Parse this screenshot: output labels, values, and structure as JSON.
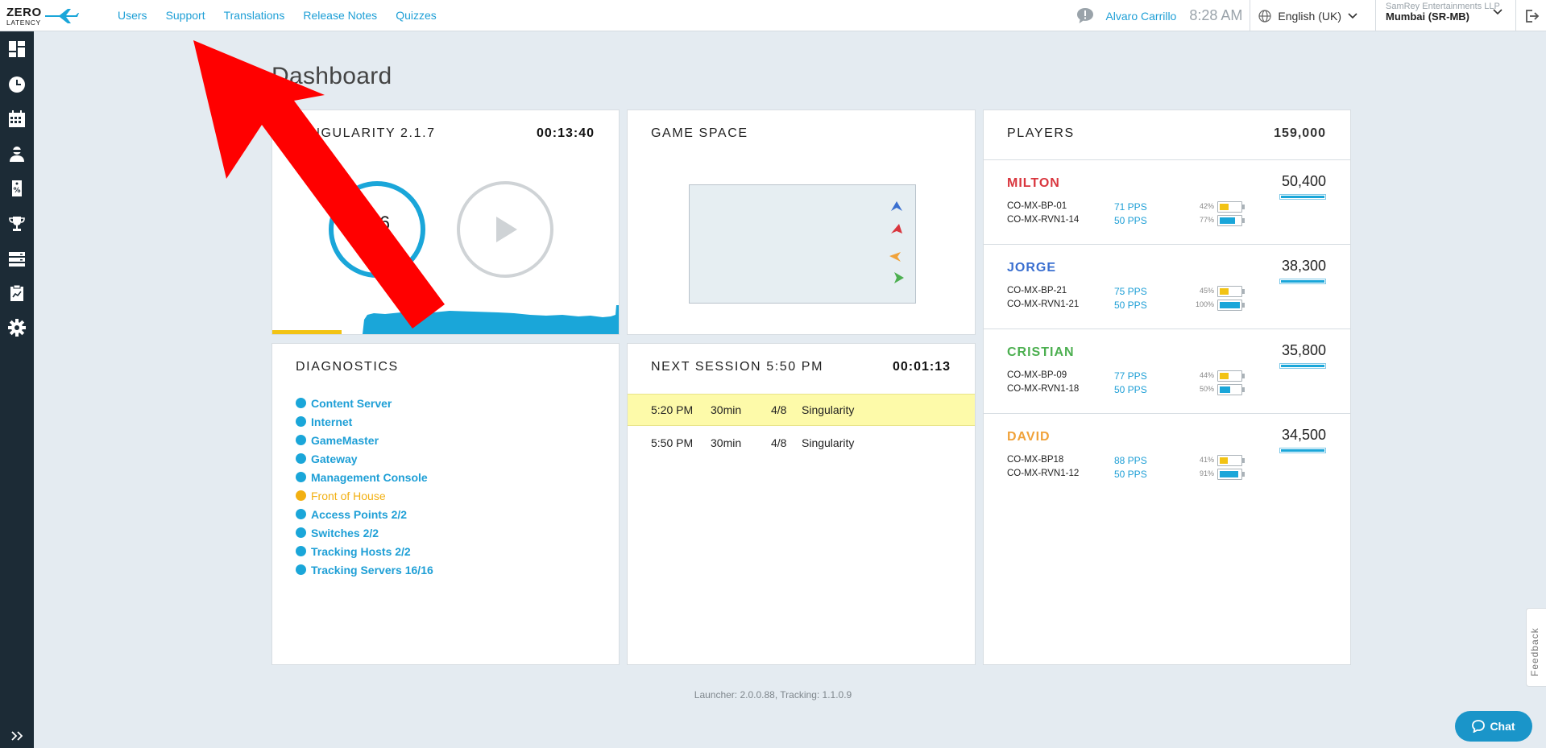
{
  "app": {
    "logo_line1": "ZERO",
    "logo_line2": "LATENCY"
  },
  "nav": {
    "users": "Users",
    "support": "Support",
    "translations": "Translations",
    "release_notes": "Release Notes",
    "quizzes": "Quizzes"
  },
  "header": {
    "user_name": "Alvaro Carrillo",
    "time": "8:28 AM",
    "language": "English (UK)",
    "company": "SamRey Entertainments LLP",
    "venue": "Mumbai (SR-MB)"
  },
  "page": {
    "title": "Dashboard"
  },
  "singularity": {
    "title": "SINGULARITY 2.1.7",
    "timer": "00:13:40",
    "count": "396"
  },
  "game_space": {
    "title": "GAME SPACE"
  },
  "diagnostics": {
    "title": "DIAGNOSTICS",
    "items": [
      {
        "label": "Content Server",
        "status": "ok"
      },
      {
        "label": "Internet",
        "status": "ok"
      },
      {
        "label": "GameMaster",
        "status": "ok"
      },
      {
        "label": "Gateway",
        "status": "ok"
      },
      {
        "label": "Management Console",
        "status": "ok"
      },
      {
        "label": "Front of House",
        "status": "warn"
      },
      {
        "label": "Access Points 2/2",
        "status": "ok"
      },
      {
        "label": "Switches 2/2",
        "status": "ok"
      },
      {
        "label": "Tracking Hosts 2/2",
        "status": "ok"
      },
      {
        "label": "Tracking Servers 16/16",
        "status": "ok"
      }
    ]
  },
  "sessions": {
    "title": "NEXT SESSION 5:50 PM",
    "timer": "00:01:13",
    "rows": [
      {
        "time": "5:20 PM",
        "duration": "30min",
        "players": "4/8",
        "game": "Singularity"
      },
      {
        "time": "5:50 PM",
        "duration": "30min",
        "players": "4/8",
        "game": "Singularity"
      }
    ]
  },
  "players": {
    "title": "PLAYERS",
    "total": "159,000",
    "list": [
      {
        "name": "MILTON",
        "color": "#d9363e",
        "score": "50,400",
        "devices": [
          {
            "name": "CO-MX-BP-01",
            "pps": "71 PPS",
            "pct": "42%",
            "level": 0.42,
            "color": "#f2c314"
          },
          {
            "name": "CO-MX-RVN1-14",
            "pps": "50 PPS",
            "pct": "77%",
            "level": 0.77,
            "color": "#1aa6d9"
          }
        ]
      },
      {
        "name": "JORGE",
        "color": "#3a6fd0",
        "score": "38,300",
        "devices": [
          {
            "name": "CO-MX-BP-21",
            "pps": "75 PPS",
            "pct": "45%",
            "level": 0.45,
            "color": "#f2c314"
          },
          {
            "name": "CO-MX-RVN1-21",
            "pps": "50 PPS",
            "pct": "100%",
            "level": 1.0,
            "color": "#1aa6d9"
          }
        ]
      },
      {
        "name": "CRISTIAN",
        "color": "#4caf50",
        "score": "35,800",
        "devices": [
          {
            "name": "CO-MX-BP-09",
            "pps": "77 PPS",
            "pct": "44%",
            "level": 0.44,
            "color": "#f2c314"
          },
          {
            "name": "CO-MX-RVN1-18",
            "pps": "50 PPS",
            "pct": "50%",
            "level": 0.5,
            "color": "#1aa6d9"
          }
        ]
      },
      {
        "name": "DAVID",
        "color": "#f0a23a",
        "score": "34,500",
        "devices": [
          {
            "name": "CO-MX-BP18",
            "pps": "88 PPS",
            "pct": "41%",
            "level": 0.41,
            "color": "#f2c314"
          },
          {
            "name": "CO-MX-RVN1-12",
            "pps": "50 PPS",
            "pct": "91%",
            "level": 0.91,
            "color": "#1aa6d9"
          }
        ]
      }
    ]
  },
  "footer": {
    "version": "Launcher: 2.0.0.88, Tracking: 1.1.0.9",
    "feedback": "Feedback",
    "chat": "Chat"
  }
}
